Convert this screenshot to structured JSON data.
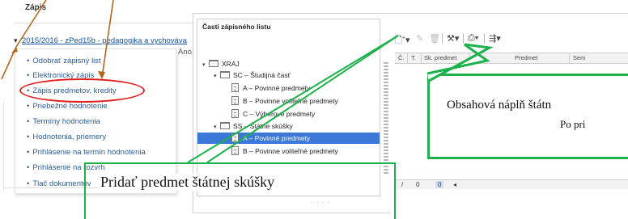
{
  "left": {
    "title": "Zápis",
    "year_link": "2015/2016 - zPed15b - pedagogika a vychováva",
    "year_value": "Áno,",
    "menu": [
      "Odobrať zápisný list",
      "Elektronický zápis",
      "Zápis predmetov, kredity",
      "Priebežné hodnotenie",
      "Termíny hodnotenia",
      "Hodnotenia, priemery",
      "Prihlásenie na termín hodnotenia",
      "Prihlásenie na rozvrh",
      "Tlač dokumentov"
    ]
  },
  "tree": {
    "title": "Časti zápisného listu",
    "root": "XRAJ",
    "nodes": [
      "SC – Študijná časť",
      "A – Povinné predmety",
      "B – Povinne voliteľné predmety",
      "C – Výberové predmety",
      "SS – Štátne skúšky",
      "A – Povinné predmety",
      "B – Povinne voliteľné predmety"
    ]
  },
  "grid": {
    "columns": [
      "Č.",
      "T.",
      "Sk. predmet",
      "Predmet",
      "Sem"
    ],
    "pager": {
      "page": "0",
      "current": "0"
    }
  },
  "callouts": {
    "big_line1": "Obsahová náplň štátn",
    "big_line2": "Po pri",
    "small": "Pridať predmet štátnej skúšky"
  },
  "colors": {
    "callout": "#1cb24b",
    "highlight": "#e02020",
    "arrow": "#b5651d",
    "selected": "#3b78d8"
  }
}
